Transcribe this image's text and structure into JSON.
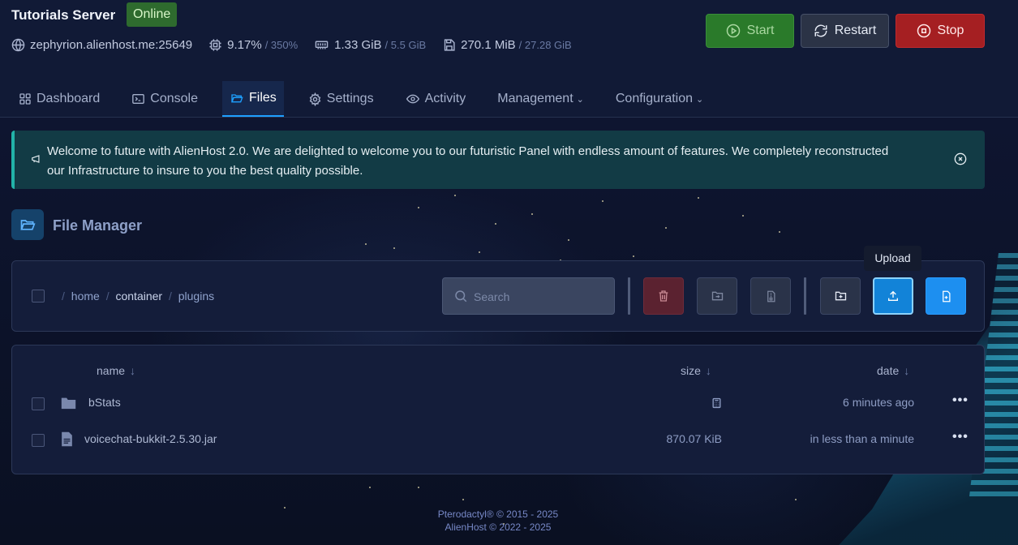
{
  "server": {
    "name": "Tutorials Server",
    "status": "Online",
    "address": "zephyrion.alienhost.me:25649",
    "cpu": "9.17%",
    "cpu_limit": "/ 350%",
    "memory": "1.33 GiB",
    "memory_limit": "/ 5.5 GiB",
    "disk": "270.1 MiB",
    "disk_limit": "/ 27.28 GiB"
  },
  "power": {
    "start": "Start",
    "restart": "Restart",
    "stop": "Stop"
  },
  "tabs": [
    {
      "label": "Dashboard",
      "icon": "grid-icon"
    },
    {
      "label": "Console",
      "icon": "terminal-icon"
    },
    {
      "label": "Files",
      "icon": "folder-open-icon",
      "active": true
    },
    {
      "label": "Settings",
      "icon": "gear-icon"
    },
    {
      "label": "Activity",
      "icon": "eye-icon"
    },
    {
      "label": "Management",
      "dropdown": true
    },
    {
      "label": "Configuration",
      "dropdown": true
    }
  ],
  "announcement": {
    "text": "Welcome to future with AlienHost 2.0. We are delighted to welcome you to our futuristic Panel with endless amount of features. We completely reconstructed our Infrastructure to insure to you the best quality possible."
  },
  "file_manager": {
    "title": "File Manager",
    "breadcrumb": [
      "home",
      "container",
      "plugins"
    ],
    "search_placeholder": "Search",
    "tooltip": "Upload",
    "columns": {
      "name": "name",
      "size": "size",
      "date": "date",
      "sort_arrow": "↓"
    },
    "files": [
      {
        "name": "bStats",
        "type": "folder",
        "size": "",
        "date": "6 minutes ago"
      },
      {
        "name": "voicechat-bukkit-2.5.30.jar",
        "type": "file",
        "size": "870.07 KiB",
        "date": "in less than a minute"
      }
    ]
  },
  "footer": {
    "line1": "Pterodactyl® © 2015 - 2025",
    "line2": "AlienHost © 2022 - 2025"
  },
  "colors": {
    "accent": "#1ea0ff",
    "online": "#2e6b2e",
    "start": "#2a7a2a",
    "stop": "#a51f22",
    "announcement_border": "#22b3a8"
  }
}
